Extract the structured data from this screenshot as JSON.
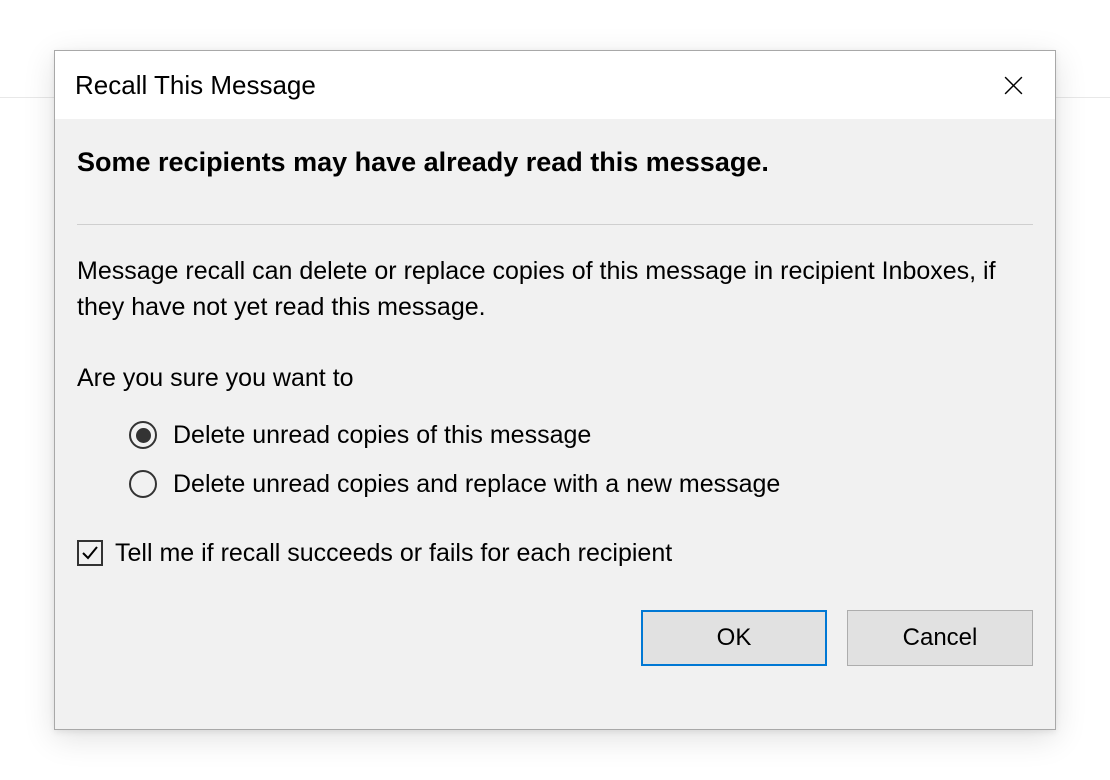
{
  "dialog": {
    "title": "Recall This Message",
    "headline": "Some recipients may have already read this message.",
    "body": "Message recall can delete or replace copies of this message in recipient Inboxes, if they have not yet read this message.",
    "prompt": "Are you sure you want to",
    "options": {
      "delete": {
        "label": "Delete unread copies of this message",
        "selected": true
      },
      "replace": {
        "label": "Delete unread copies and replace with a new message",
        "selected": false
      }
    },
    "notify": {
      "label": "Tell me if recall succeeds or fails for each recipient",
      "checked": true
    },
    "buttons": {
      "ok": "OK",
      "cancel": "Cancel"
    }
  }
}
